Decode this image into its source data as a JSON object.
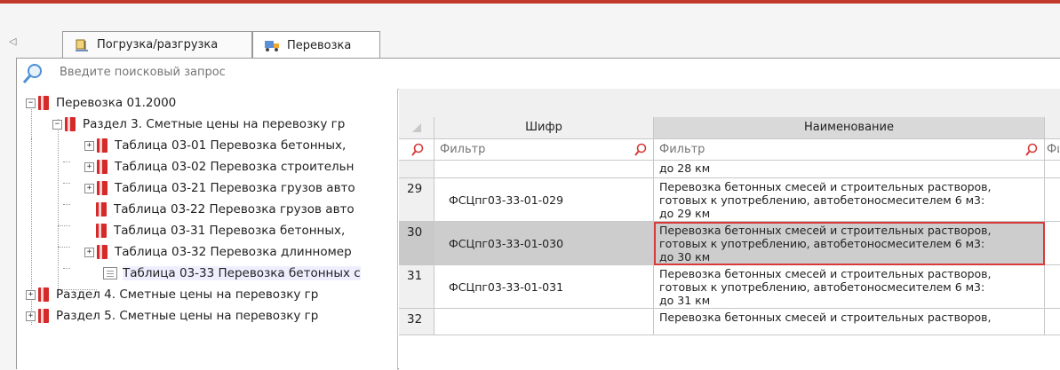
{
  "tabs": [
    {
      "label": "Погрузка/разгрузка",
      "icon": "loading-icon",
      "active": false
    },
    {
      "label": "Перевозка",
      "icon": "truck-icon",
      "active": true
    }
  ],
  "search": {
    "placeholder": "Введите поисковый запрос"
  },
  "tree": {
    "root": "Перевозка 01.2000",
    "section3": "Раздел 3. Сметные цены на перевозку гр",
    "tables": [
      "Таблица 03-01 Перевозка бетонных,",
      "Таблица 03-02 Перевозка строительн",
      "Таблица 03-21 Перевозка грузов авто",
      "Таблица 03-22 Перевозка грузов авто",
      "Таблица 03-31 Перевозка бетонных,",
      "Таблица 03-32 Перевозка длинномер",
      "Таблица 03-33 Перевозка бетонных с"
    ],
    "section4": "Раздел 4. Сметные цены на перевозку гр",
    "section5": "Раздел 5. Сметные цены на перевозку гр"
  },
  "grid": {
    "headers": {
      "code": "Шифр",
      "name": "Наименование"
    },
    "filter": {
      "placeholder_code": "Фильтр",
      "placeholder_name": "Фильтр",
      "placeholder_next": "Фил"
    },
    "partial_top_name": "до 28 км",
    "rows": [
      {
        "num": "29",
        "code": "ФСЦпг03-33-01-029",
        "name1": "Перевозка бетонных смесей и строительных растворов,",
        "name2": "готовых к употреблению, автобетоносмесителем 6 м3:",
        "name3": "до 29 км"
      },
      {
        "num": "30",
        "code": "ФСЦпг03-33-01-030",
        "name1": "Перевозка бетонных смесей и строительных растворов,",
        "name2": "готовых к употреблению, автобетоносмесителем 6 м3:",
        "name3": "до 30 км"
      },
      {
        "num": "31",
        "code": "ФСЦпг03-33-01-031",
        "name1": "Перевозка бетонных смесей и строительных растворов,",
        "name2": "готовых к употреблению, автобетоносмесителем 6 м3:",
        "name3": "до 31 км"
      }
    ],
    "partial_bottom": {
      "num": "32",
      "name1": "Перевозка бетонных смесей и строительных растворов,"
    }
  },
  "colors": {
    "accent": "#c0392b",
    "selection_border": "#d63a3a",
    "book_icon": "#d42a2a"
  }
}
